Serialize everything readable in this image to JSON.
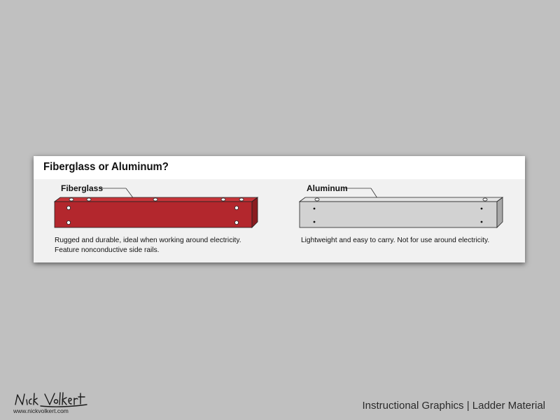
{
  "card": {
    "title": "Fiberglass or Aluminum?"
  },
  "materials": [
    {
      "label": "Fiberglass",
      "caption_lines": [
        "Rugged and durable, ideal when working around electricity.",
        "Feature nonconductive side rails."
      ],
      "rail_color": "#b3272d",
      "rail_top_color": "#c8353a",
      "rail_edge_color": "#8a1c20"
    },
    {
      "label": "Aluminum",
      "caption_lines": [
        "Lightweight and easy to carry.  Not for use around electricity."
      ],
      "rail_color": "#d2d2d2",
      "rail_top_color": "#e4e4e4",
      "rail_edge_color": "#a9a9a9"
    }
  ],
  "footer": {
    "signature": "Nick Volkert",
    "url": "www.nickvolkert.com",
    "caption": "Instructional Graphics | Ladder Material"
  }
}
